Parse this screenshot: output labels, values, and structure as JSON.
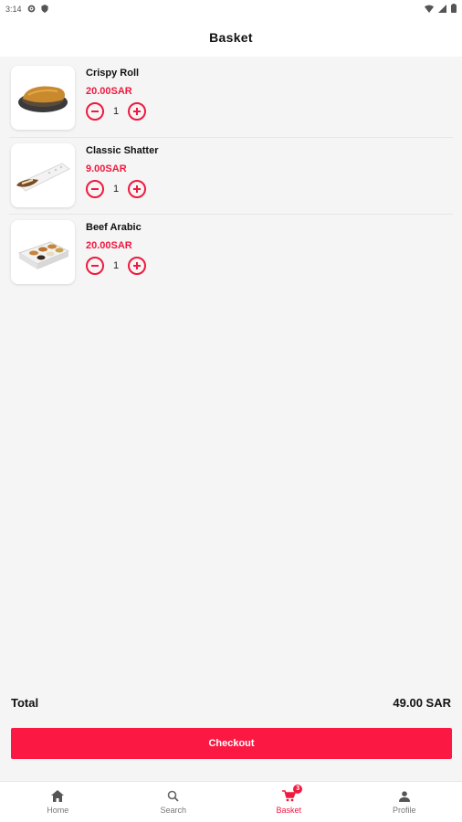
{
  "status_bar": {
    "time": "3:14"
  },
  "app_bar": {
    "title": "Basket"
  },
  "items": [
    {
      "name": "Crispy Roll",
      "price": "20.00SAR",
      "quantity": "1"
    },
    {
      "name": "Classic Shatter",
      "price": "9.00SAR",
      "quantity": "1"
    },
    {
      "name": "Beef Arabic",
      "price": "20.00SAR",
      "quantity": "1"
    }
  ],
  "summary": {
    "total_label": "Total",
    "total_value": "49.00 SAR"
  },
  "checkout": {
    "label": "Checkout"
  },
  "nav": {
    "home": "Home",
    "search": "Search",
    "basket": "Basket",
    "basket_badge": "3",
    "profile": "Profile"
  },
  "colors": {
    "accent": "#f0193f",
    "button": "#fb1944"
  }
}
